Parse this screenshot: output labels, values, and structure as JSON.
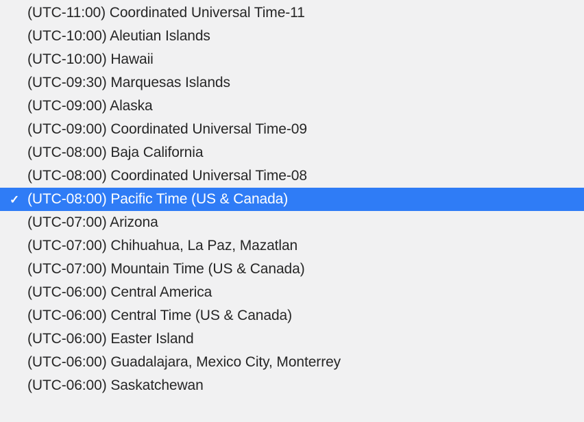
{
  "timezones": {
    "items": [
      {
        "label": "(UTC-11:00) Coordinated Universal Time-11",
        "selected": false
      },
      {
        "label": "(UTC-10:00) Aleutian Islands",
        "selected": false
      },
      {
        "label": "(UTC-10:00) Hawaii",
        "selected": false
      },
      {
        "label": "(UTC-09:30) Marquesas Islands",
        "selected": false
      },
      {
        "label": "(UTC-09:00) Alaska",
        "selected": false
      },
      {
        "label": "(UTC-09:00) Coordinated Universal Time-09",
        "selected": false
      },
      {
        "label": "(UTC-08:00) Baja California",
        "selected": false
      },
      {
        "label": "(UTC-08:00) Coordinated Universal Time-08",
        "selected": false
      },
      {
        "label": "(UTC-08:00) Pacific Time (US & Canada)",
        "selected": true
      },
      {
        "label": "(UTC-07:00) Arizona",
        "selected": false
      },
      {
        "label": "(UTC-07:00) Chihuahua, La Paz, Mazatlan",
        "selected": false
      },
      {
        "label": "(UTC-07:00) Mountain Time (US & Canada)",
        "selected": false
      },
      {
        "label": "(UTC-06:00) Central America",
        "selected": false
      },
      {
        "label": "(UTC-06:00) Central Time (US & Canada)",
        "selected": false
      },
      {
        "label": "(UTC-06:00) Easter Island",
        "selected": false
      },
      {
        "label": "(UTC-06:00) Guadalajara, Mexico City, Monterrey",
        "selected": false
      },
      {
        "label": "(UTC-06:00) Saskatchewan",
        "selected": false
      }
    ]
  },
  "colors": {
    "selected_bg": "#2f7cf6",
    "text": "#262626",
    "selected_text": "#ffffff",
    "background": "#f1f1f2"
  },
  "icons": {
    "checkmark": "✓"
  }
}
